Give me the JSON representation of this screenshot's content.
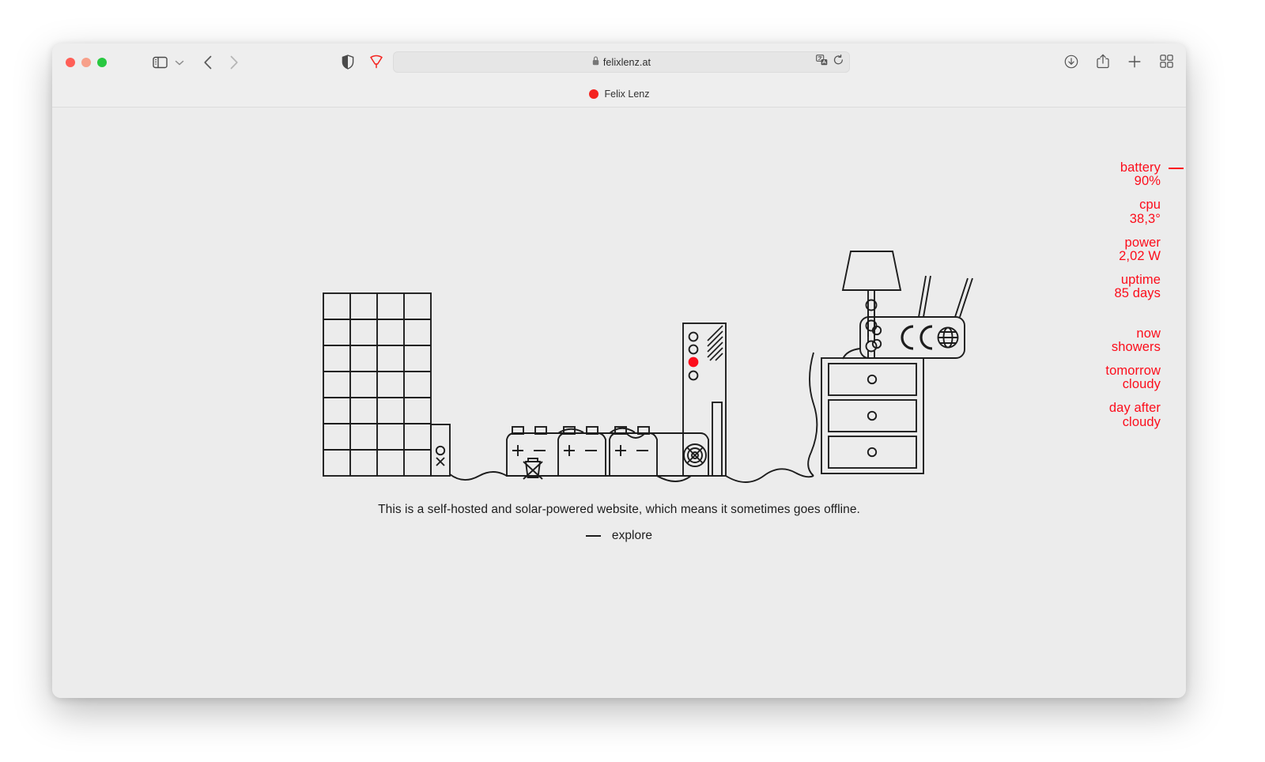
{
  "browser": {
    "address": "felixlenz.at",
    "lock_icon": "lock-icon",
    "tab": {
      "title": "Felix Lenz",
      "favicon": "red-circle-favicon"
    },
    "toolbar_icons": [
      "sidebar-icon",
      "chevron-down-icon",
      "back-arrow-icon",
      "forward-arrow-icon",
      "shield-icon",
      "wiper-icon",
      "translate-icon",
      "reload-icon",
      "downloads-icon",
      "share-icon",
      "new-tab-icon",
      "tab-overview-icon"
    ]
  },
  "stats": [
    {
      "label": "battery",
      "value": "90%",
      "dash": true
    },
    {
      "label": "cpu",
      "value": "38,3°",
      "dash": false
    },
    {
      "label": "power",
      "value": "2,02 W",
      "dash": false
    },
    {
      "label": "uptime",
      "value": "85 days",
      "dash": false
    }
  ],
  "weather": [
    {
      "label": "now",
      "value": "showers"
    },
    {
      "label": "tomorrow",
      "value": "cloudy"
    },
    {
      "label": "day after",
      "value": "cloudy"
    }
  ],
  "main": {
    "tagline": "This is a self-hosted and solar-powered website, which means it sometimes goes offline.",
    "explore_label": "explore"
  },
  "illustration": {
    "solar_panel": {
      "columns": 4,
      "rows": 7
    },
    "charge_controller": {
      "symbols": [
        "circle",
        "x"
      ]
    },
    "batteries": {
      "count": 3,
      "terminals": [
        "+",
        "−"
      ],
      "recycle_mark": "crossed-out-bin"
    },
    "server": {
      "leds": 4,
      "active_led_index": 3,
      "active_led_color": "#fc0d1b",
      "fan": true
    },
    "lamp": {
      "shade": "trapezoid",
      "beads": 3
    },
    "router": {
      "antennas": 2,
      "marking": "CE",
      "globe_icon": true,
      "ports": 2
    },
    "dresser": {
      "drawers": 3,
      "knobs": 3
    }
  },
  "colors": {
    "accent": "#fc0d1b",
    "page_bg": "#ececec",
    "line": "#1d1d1d"
  }
}
